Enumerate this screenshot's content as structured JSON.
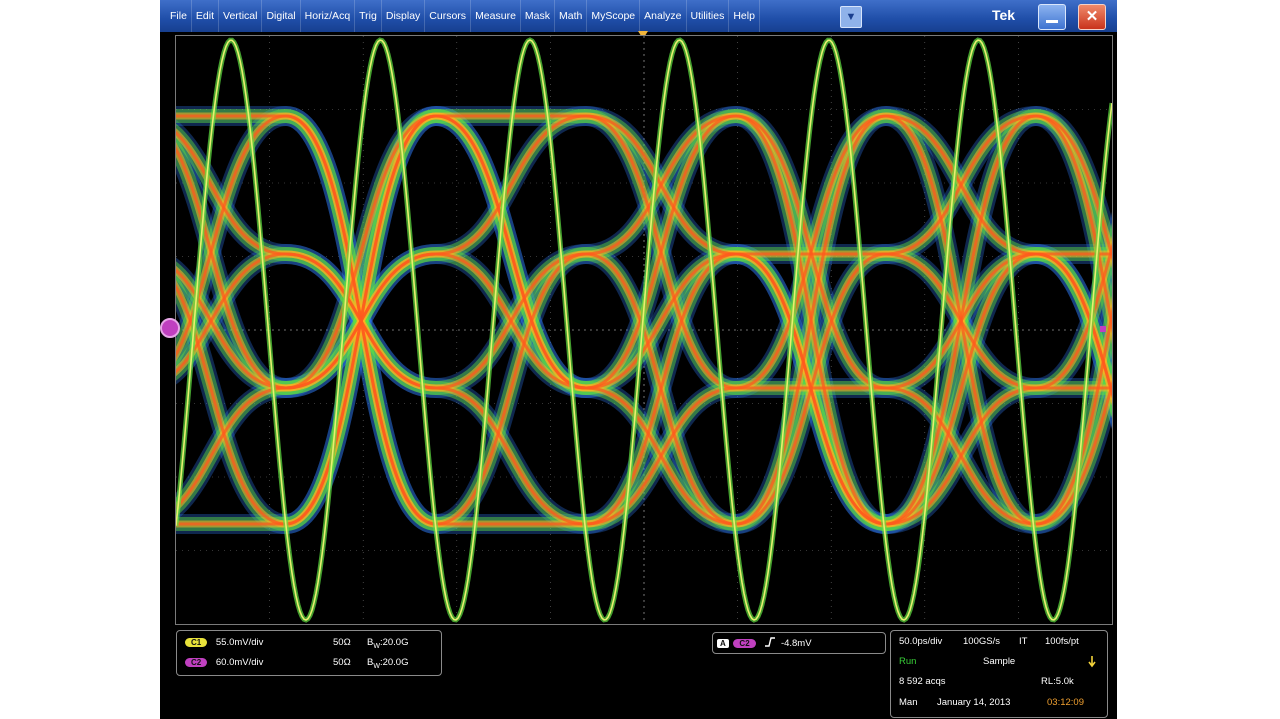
{
  "menubar": {
    "items": [
      "File",
      "Edit",
      "Vertical",
      "Digital",
      "Horiz/Acq",
      "Trig",
      "Display",
      "Cursors",
      "Measure",
      "Mask",
      "Math",
      "MyScope",
      "Analyze",
      "Utilities",
      "Help"
    ],
    "dropdown": "▼",
    "brand": "Tek",
    "close": "✕"
  },
  "channels": [
    {
      "chip": "C1",
      "scale": "55.0mV/div",
      "impedance": "50Ω",
      "bandwidth": "20.0G",
      "color": "#e8e23a"
    },
    {
      "chip": "C2",
      "scale": "60.0mV/div",
      "impedance": "50Ω",
      "bandwidth": "20.0G",
      "color": "#c040c0"
    }
  ],
  "bw_prefix": "B",
  "bw_sub": "W",
  "trigger": {
    "source_chip": "C2",
    "level": "-4.8mV",
    "slope_icon": "rising-edge-icon"
  },
  "acquisition": {
    "timebase": "50.0ps/div",
    "sample_rate": "100GS/s",
    "mode_code": "IT",
    "resolution": "100fs/pt",
    "state": "Run",
    "acq_mode": "Sample",
    "acqs": "8 592 acqs",
    "record_length": "RL:5.0k",
    "user": "Man",
    "date": "January 14, 2013",
    "time": "03:12:09"
  },
  "colors": {
    "trace_core": "#ff5a1e",
    "trace_mid": "#ffb020",
    "trace_outer": "#60e040",
    "trace_edge": "#2a6fe0",
    "grid": "#6b6b6b"
  }
}
